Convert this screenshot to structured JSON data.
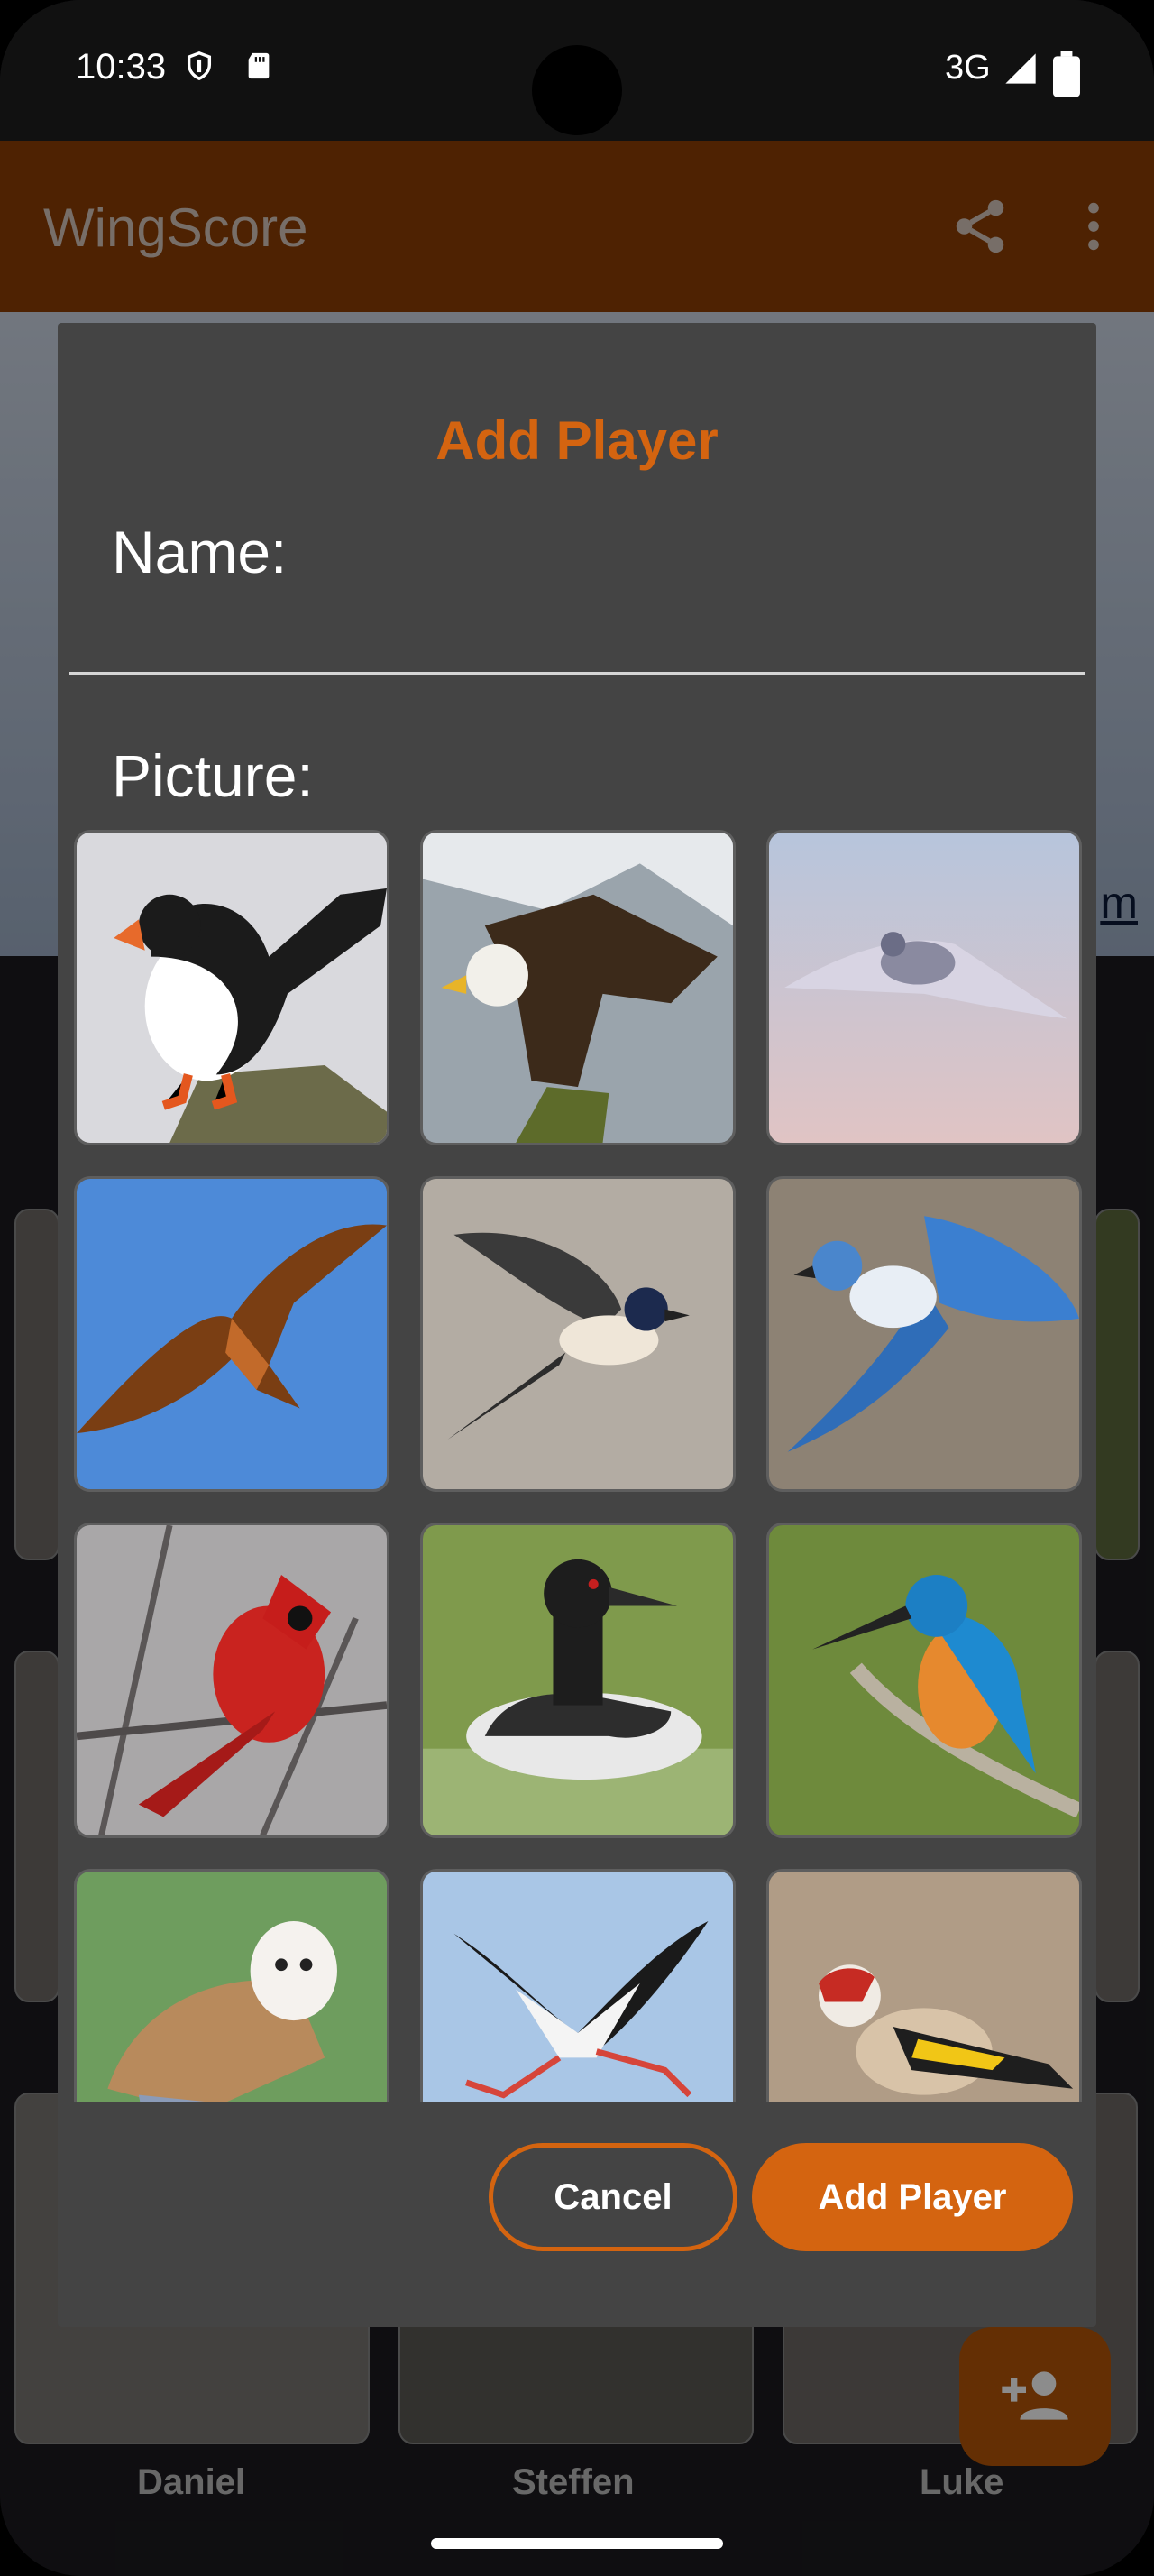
{
  "status_bar": {
    "time": "10:33",
    "network": "3G"
  },
  "app_bar": {
    "title": "WingScore",
    "share_icon": "share-icon",
    "menu_icon": "more-vert-icon"
  },
  "background": {
    "link_fragment": "m",
    "players": [
      {
        "name": "Daniel"
      },
      {
        "name": "Steffen"
      },
      {
        "name": "Luke"
      }
    ],
    "fab_icon": "person-add-icon"
  },
  "dialog": {
    "title": "Add Player",
    "name_label": "Name:",
    "name_value": "",
    "picture_label": "Picture:",
    "pictures": [
      {
        "bird": "puffin"
      },
      {
        "bird": "bald-eagle"
      },
      {
        "bird": "pigeon"
      },
      {
        "bird": "red-kite"
      },
      {
        "bird": "swallow"
      },
      {
        "bird": "blue-jay"
      },
      {
        "bird": "cardinal"
      },
      {
        "bird": "loon"
      },
      {
        "bird": "kingfisher"
      },
      {
        "bird": "barn-owl"
      },
      {
        "bird": "stork"
      },
      {
        "bird": "goldfinch"
      }
    ],
    "cancel_label": "Cancel",
    "confirm_label": "Add Player"
  },
  "colors": {
    "accent": "#d46410",
    "app_bar": "#8f3e05",
    "dialog_bg": "#444444"
  }
}
